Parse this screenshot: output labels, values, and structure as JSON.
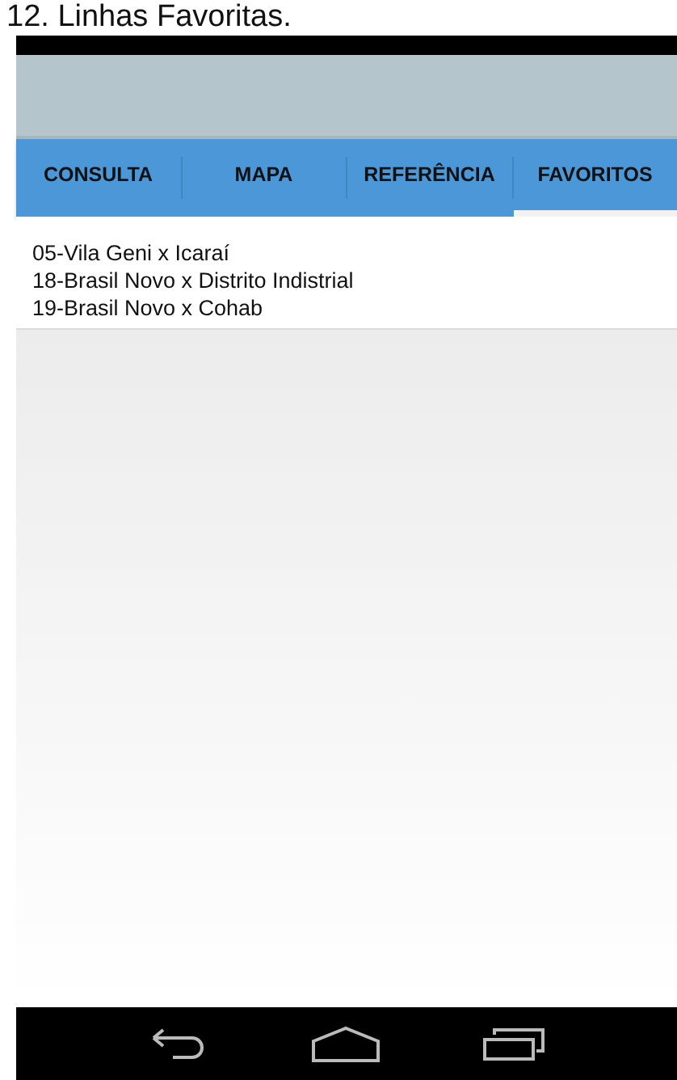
{
  "page_title": "12. Linhas Favoritas.",
  "tabs": [
    {
      "label": "CONSULTA",
      "selected": false
    },
    {
      "label": "MAPA",
      "selected": false
    },
    {
      "label": "REFERÊNCIA",
      "selected": false
    },
    {
      "label": "FAVORITOS",
      "selected": true
    }
  ],
  "favorites": [
    "05-Vila Geni x Icaraí",
    "18-Brasil Novo x Distrito Indistrial",
    "19-Brasil Novo x Cohab"
  ]
}
